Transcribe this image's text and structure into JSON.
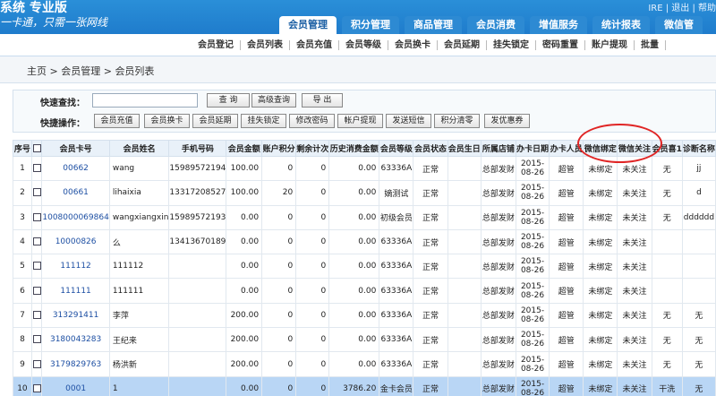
{
  "app": {
    "title": "系统 专业版",
    "slogan": "一卡通，只需一张网线",
    "top_right": "IRE | 退出 | 帮助"
  },
  "nav": {
    "tabs": [
      {
        "label": "会员管理",
        "active": true
      },
      {
        "label": "积分管理",
        "active": false
      },
      {
        "label": "商品管理",
        "active": false
      },
      {
        "label": "会员消费",
        "active": false
      },
      {
        "label": "增值服务",
        "active": false
      },
      {
        "label": "统计报表",
        "active": false
      },
      {
        "label": "微信管",
        "active": false
      }
    ]
  },
  "subnav": {
    "items": [
      "会员登记",
      "会员列表",
      "会员充值",
      "会员等级",
      "会员换卡",
      "会员延期",
      "挂失锁定",
      "密码重置",
      "账户提现",
      "批量"
    ]
  },
  "breadcrumb": {
    "home": "主页",
    "sep1": ">",
    "section": "会员管理",
    "sep2": ">",
    "page": "会员列表"
  },
  "search": {
    "quick_label": "快速查找：",
    "quick_value": "",
    "buttons": [
      "查 询",
      "高级查询",
      "导 出"
    ],
    "ops_label": "快捷操作：",
    "ops": [
      "会员充值",
      "会员换卡",
      "会员延期",
      "挂失锁定",
      "修改密码",
      "帐户提现",
      "发送短信",
      "积分清零",
      "发优惠券"
    ]
  },
  "table": {
    "headers": [
      "序号",
      "",
      "会员卡号",
      "会员姓名",
      "手机号码",
      "会员金额",
      "账户积分",
      "剩余计次",
      "历史消费金额",
      "会员等级",
      "会员状态",
      "会员生日",
      "所属店铺",
      "办卡日期",
      "办卡人员",
      "微信绑定",
      "微信关注",
      "会员喜1",
      "诊断名称"
    ],
    "rows": [
      [
        "1",
        "",
        "00662",
        "wang",
        "15989572194",
        "100.00",
        "0",
        "0",
        "0.00",
        "63336A",
        "正常",
        "",
        "总部发财",
        "2015-08-26",
        "超管",
        "未绑定",
        "未关注",
        "无",
        "jj"
      ],
      [
        "2",
        "",
        "00661",
        "lihaixia",
        "13317208527",
        "100.00",
        "20",
        "0",
        "0.00",
        "嫡测试",
        "正常",
        "",
        "总部发财",
        "2015-08-26",
        "超管",
        "未绑定",
        "未关注",
        "无",
        "d"
      ],
      [
        "3",
        "",
        "1008000069864",
        "wangxiangxin",
        "15989572193",
        "0.00",
        "0",
        "0",
        "0.00",
        "初级会员",
        "正常",
        "",
        "总部发财",
        "2015-08-26",
        "超管",
        "未绑定",
        "未关注",
        "无",
        "dddddd"
      ],
      [
        "4",
        "",
        "10000826",
        "么",
        "13413670189",
        "0.00",
        "0",
        "0",
        "0.00",
        "63336A",
        "正常",
        "",
        "总部发财",
        "2015-08-26",
        "超管",
        "未绑定",
        "未关注",
        "",
        ""
      ],
      [
        "5",
        "",
        "111112",
        "111112",
        "",
        "0.00",
        "0",
        "0",
        "0.00",
        "63336A",
        "正常",
        "",
        "总部发财",
        "2015-08-26",
        "超管",
        "未绑定",
        "未关注",
        "",
        ""
      ],
      [
        "6",
        "",
        "111111",
        "111111",
        "",
        "0.00",
        "0",
        "0",
        "0.00",
        "63336A",
        "正常",
        "",
        "总部发财",
        "2015-08-26",
        "超管",
        "未绑定",
        "未关注",
        "",
        ""
      ],
      [
        "7",
        "",
        "313291411",
        "李萍",
        "",
        "200.00",
        "0",
        "0",
        "0.00",
        "63336A",
        "正常",
        "",
        "总部发财",
        "2015-08-26",
        "超管",
        "未绑定",
        "未关注",
        "无",
        "无"
      ],
      [
        "8",
        "",
        "3180043283",
        "王纪来",
        "",
        "200.00",
        "0",
        "0",
        "0.00",
        "63336A",
        "正常",
        "",
        "总部发财",
        "2015-08-26",
        "超管",
        "未绑定",
        "未关注",
        "无",
        "无"
      ],
      [
        "9",
        "",
        "3179829763",
        "杨洪新",
        "",
        "200.00",
        "0",
        "0",
        "0.00",
        "63336A",
        "正常",
        "",
        "总部发财",
        "2015-08-26",
        "超管",
        "未绑定",
        "未关注",
        "无",
        "无"
      ],
      [
        "10",
        "",
        "0001",
        "1",
        "",
        "0.00",
        "0",
        "0",
        "3786.20",
        "金卡会员",
        "正常",
        "",
        "总部发财",
        "2015-08-26",
        "超管",
        "未绑定",
        "未关注",
        "干洗",
        "无"
      ]
    ],
    "selected_row": 9
  },
  "colors": {
    "header_bg": "#1f7ccc",
    "selected_row": "#b9d6f5",
    "annotation": "#e02525"
  }
}
